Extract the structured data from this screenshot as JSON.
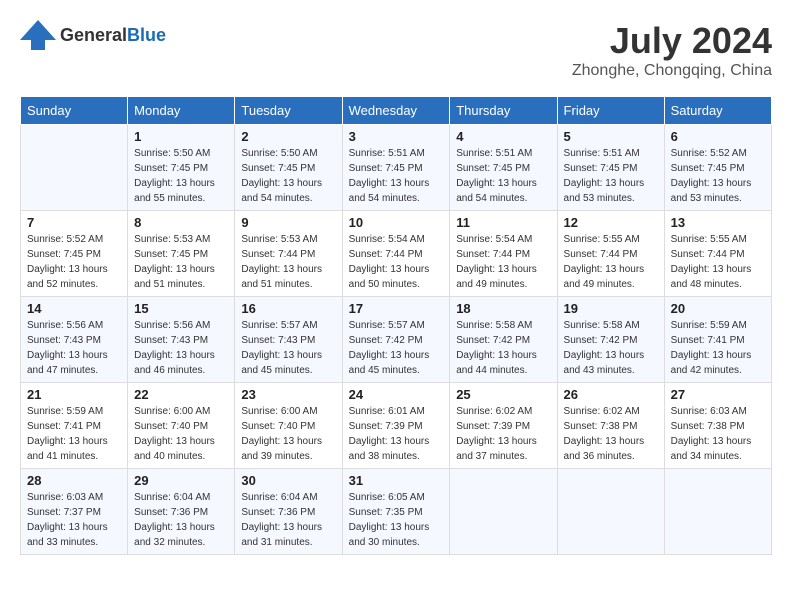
{
  "header": {
    "logo_general": "General",
    "logo_blue": "Blue",
    "month_year": "July 2024",
    "location": "Zhonghe, Chongqing, China"
  },
  "weekdays": [
    "Sunday",
    "Monday",
    "Tuesday",
    "Wednesday",
    "Thursday",
    "Friday",
    "Saturday"
  ],
  "weeks": [
    [
      {
        "day": "",
        "sunrise": "",
        "sunset": "",
        "daylight": ""
      },
      {
        "day": "1",
        "sunrise": "Sunrise: 5:50 AM",
        "sunset": "Sunset: 7:45 PM",
        "daylight": "Daylight: 13 hours and 55 minutes."
      },
      {
        "day": "2",
        "sunrise": "Sunrise: 5:50 AM",
        "sunset": "Sunset: 7:45 PM",
        "daylight": "Daylight: 13 hours and 54 minutes."
      },
      {
        "day": "3",
        "sunrise": "Sunrise: 5:51 AM",
        "sunset": "Sunset: 7:45 PM",
        "daylight": "Daylight: 13 hours and 54 minutes."
      },
      {
        "day": "4",
        "sunrise": "Sunrise: 5:51 AM",
        "sunset": "Sunset: 7:45 PM",
        "daylight": "Daylight: 13 hours and 54 minutes."
      },
      {
        "day": "5",
        "sunrise": "Sunrise: 5:51 AM",
        "sunset": "Sunset: 7:45 PM",
        "daylight": "Daylight: 13 hours and 53 minutes."
      },
      {
        "day": "6",
        "sunrise": "Sunrise: 5:52 AM",
        "sunset": "Sunset: 7:45 PM",
        "daylight": "Daylight: 13 hours and 53 minutes."
      }
    ],
    [
      {
        "day": "7",
        "sunrise": "Sunrise: 5:52 AM",
        "sunset": "Sunset: 7:45 PM",
        "daylight": "Daylight: 13 hours and 52 minutes."
      },
      {
        "day": "8",
        "sunrise": "Sunrise: 5:53 AM",
        "sunset": "Sunset: 7:45 PM",
        "daylight": "Daylight: 13 hours and 51 minutes."
      },
      {
        "day": "9",
        "sunrise": "Sunrise: 5:53 AM",
        "sunset": "Sunset: 7:44 PM",
        "daylight": "Daylight: 13 hours and 51 minutes."
      },
      {
        "day": "10",
        "sunrise": "Sunrise: 5:54 AM",
        "sunset": "Sunset: 7:44 PM",
        "daylight": "Daylight: 13 hours and 50 minutes."
      },
      {
        "day": "11",
        "sunrise": "Sunrise: 5:54 AM",
        "sunset": "Sunset: 7:44 PM",
        "daylight": "Daylight: 13 hours and 49 minutes."
      },
      {
        "day": "12",
        "sunrise": "Sunrise: 5:55 AM",
        "sunset": "Sunset: 7:44 PM",
        "daylight": "Daylight: 13 hours and 49 minutes."
      },
      {
        "day": "13",
        "sunrise": "Sunrise: 5:55 AM",
        "sunset": "Sunset: 7:44 PM",
        "daylight": "Daylight: 13 hours and 48 minutes."
      }
    ],
    [
      {
        "day": "14",
        "sunrise": "Sunrise: 5:56 AM",
        "sunset": "Sunset: 7:43 PM",
        "daylight": "Daylight: 13 hours and 47 minutes."
      },
      {
        "day": "15",
        "sunrise": "Sunrise: 5:56 AM",
        "sunset": "Sunset: 7:43 PM",
        "daylight": "Daylight: 13 hours and 46 minutes."
      },
      {
        "day": "16",
        "sunrise": "Sunrise: 5:57 AM",
        "sunset": "Sunset: 7:43 PM",
        "daylight": "Daylight: 13 hours and 45 minutes."
      },
      {
        "day": "17",
        "sunrise": "Sunrise: 5:57 AM",
        "sunset": "Sunset: 7:42 PM",
        "daylight": "Daylight: 13 hours and 45 minutes."
      },
      {
        "day": "18",
        "sunrise": "Sunrise: 5:58 AM",
        "sunset": "Sunset: 7:42 PM",
        "daylight": "Daylight: 13 hours and 44 minutes."
      },
      {
        "day": "19",
        "sunrise": "Sunrise: 5:58 AM",
        "sunset": "Sunset: 7:42 PM",
        "daylight": "Daylight: 13 hours and 43 minutes."
      },
      {
        "day": "20",
        "sunrise": "Sunrise: 5:59 AM",
        "sunset": "Sunset: 7:41 PM",
        "daylight": "Daylight: 13 hours and 42 minutes."
      }
    ],
    [
      {
        "day": "21",
        "sunrise": "Sunrise: 5:59 AM",
        "sunset": "Sunset: 7:41 PM",
        "daylight": "Daylight: 13 hours and 41 minutes."
      },
      {
        "day": "22",
        "sunrise": "Sunrise: 6:00 AM",
        "sunset": "Sunset: 7:40 PM",
        "daylight": "Daylight: 13 hours and 40 minutes."
      },
      {
        "day": "23",
        "sunrise": "Sunrise: 6:00 AM",
        "sunset": "Sunset: 7:40 PM",
        "daylight": "Daylight: 13 hours and 39 minutes."
      },
      {
        "day": "24",
        "sunrise": "Sunrise: 6:01 AM",
        "sunset": "Sunset: 7:39 PM",
        "daylight": "Daylight: 13 hours and 38 minutes."
      },
      {
        "day": "25",
        "sunrise": "Sunrise: 6:02 AM",
        "sunset": "Sunset: 7:39 PM",
        "daylight": "Daylight: 13 hours and 37 minutes."
      },
      {
        "day": "26",
        "sunrise": "Sunrise: 6:02 AM",
        "sunset": "Sunset: 7:38 PM",
        "daylight": "Daylight: 13 hours and 36 minutes."
      },
      {
        "day": "27",
        "sunrise": "Sunrise: 6:03 AM",
        "sunset": "Sunset: 7:38 PM",
        "daylight": "Daylight: 13 hours and 34 minutes."
      }
    ],
    [
      {
        "day": "28",
        "sunrise": "Sunrise: 6:03 AM",
        "sunset": "Sunset: 7:37 PM",
        "daylight": "Daylight: 13 hours and 33 minutes."
      },
      {
        "day": "29",
        "sunrise": "Sunrise: 6:04 AM",
        "sunset": "Sunset: 7:36 PM",
        "daylight": "Daylight: 13 hours and 32 minutes."
      },
      {
        "day": "30",
        "sunrise": "Sunrise: 6:04 AM",
        "sunset": "Sunset: 7:36 PM",
        "daylight": "Daylight: 13 hours and 31 minutes."
      },
      {
        "day": "31",
        "sunrise": "Sunrise: 6:05 AM",
        "sunset": "Sunset: 7:35 PM",
        "daylight": "Daylight: 13 hours and 30 minutes."
      },
      {
        "day": "",
        "sunrise": "",
        "sunset": "",
        "daylight": ""
      },
      {
        "day": "",
        "sunrise": "",
        "sunset": "",
        "daylight": ""
      },
      {
        "day": "",
        "sunrise": "",
        "sunset": "",
        "daylight": ""
      }
    ]
  ]
}
